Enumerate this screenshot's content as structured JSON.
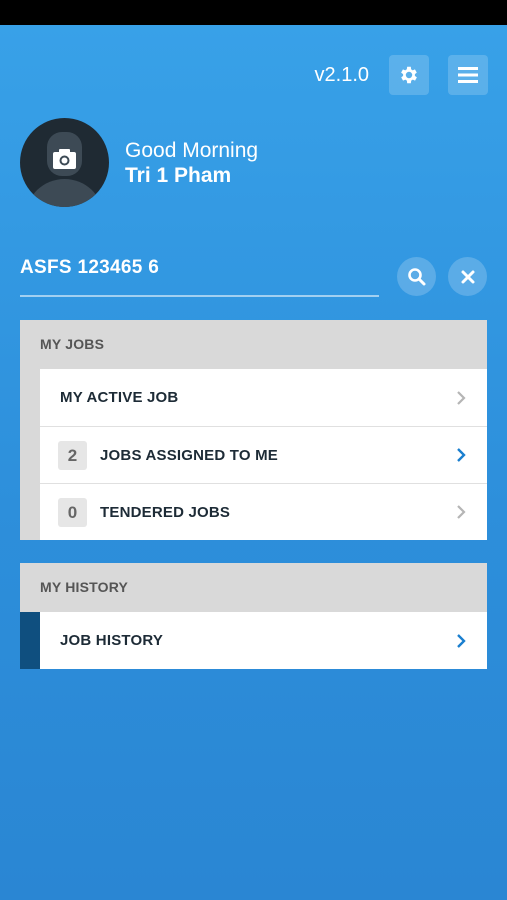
{
  "header": {
    "version": "v2.1.0"
  },
  "profile": {
    "greeting": "Good Morning",
    "name": "Tri 1 Pham"
  },
  "search": {
    "value": "ASFS 123465 6"
  },
  "my_jobs": {
    "title": "MY JOBS",
    "items": [
      {
        "label": "MY ACTIVE JOB",
        "count": null,
        "enabled": false
      },
      {
        "label": "JOBS ASSIGNED TO ME",
        "count": "2",
        "enabled": true
      },
      {
        "label": "TENDERED JOBS",
        "count": "0",
        "enabled": false
      }
    ]
  },
  "my_history": {
    "title": "MY HISTORY",
    "items": [
      {
        "label": "JOB HISTORY",
        "enabled": true
      }
    ]
  },
  "colors": {
    "background": "#2d8fdb",
    "accent_chevron": "#1a7fcf",
    "disabled_chevron": "#b5b5b5",
    "history_strip": "#0f4f7f"
  },
  "icons": {
    "settings": "gear-icon",
    "menu": "hamburger-menu-icon",
    "search": "search-icon",
    "clear": "close-icon",
    "avatar": "camera-icon",
    "chevron": "chevron-right-icon"
  }
}
